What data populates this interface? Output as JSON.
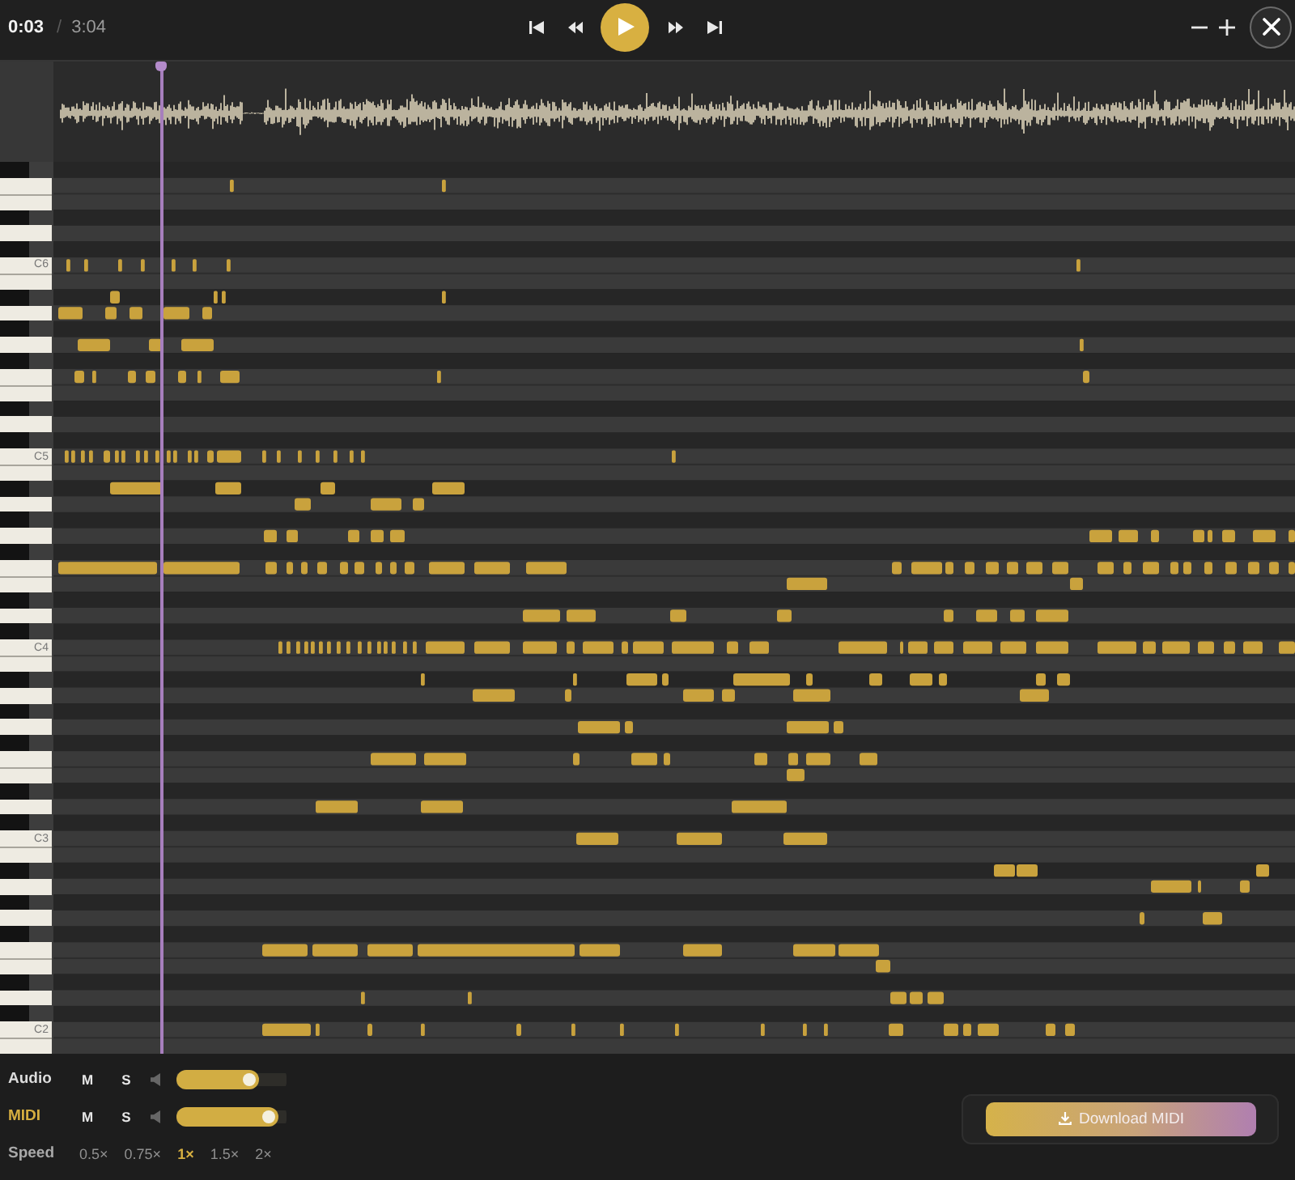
{
  "top_bar": {
    "current_time": "0:03",
    "separator": "/",
    "total_time": "3:04"
  },
  "transport": {
    "playing": false
  },
  "timeline": {
    "playhead": {
      "level": 0.087
    }
  },
  "keyboard": {
    "octave_labels": [
      "C6",
      "C5",
      "C4",
      "C3",
      "C2"
    ]
  },
  "tracks": [
    {
      "name": "Audio",
      "color": "#dcdcdc",
      "mute_label": "M",
      "muted": false,
      "solo_label": "S",
      "soloed": false,
      "volume": {
        "level": 0.75
      }
    },
    {
      "name": "MIDI",
      "color": "#d6ae40",
      "mute_label": "M",
      "muted": false,
      "solo_label": "S",
      "soloed": false,
      "volume": {
        "level": 0.93
      }
    }
  ],
  "speed": {
    "label": "Speed",
    "options": [
      {
        "label": "0.5×",
        "selected": false
      },
      {
        "label": "0.75×",
        "selected": false
      },
      {
        "label": "1×",
        "selected": true
      },
      {
        "label": "1.5×",
        "selected": false
      },
      {
        "label": "2×",
        "selected": false
      }
    ]
  },
  "download_button": {
    "label": "Download MIDI"
  }
}
